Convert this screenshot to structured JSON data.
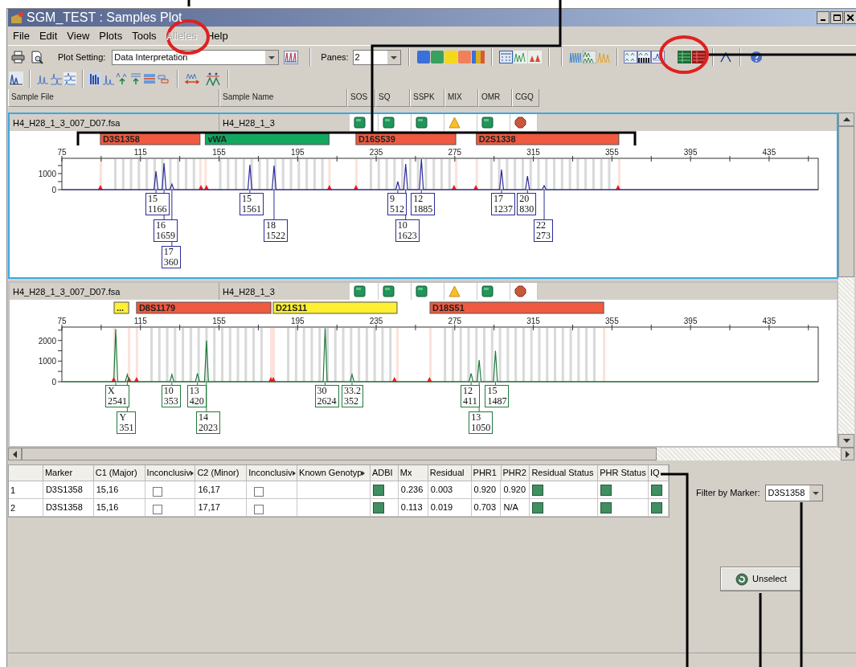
{
  "window": {
    "title": "SGM_TEST : Samples Plot"
  },
  "menu": [
    {
      "label": "File",
      "disabled": false
    },
    {
      "label": "Edit",
      "disabled": false
    },
    {
      "label": "View",
      "disabled": false
    },
    {
      "label": "Plots",
      "disabled": false
    },
    {
      "label": "Tools",
      "disabled": false
    },
    {
      "label": "Alleles",
      "disabled": true
    },
    {
      "label": "Help",
      "disabled": false
    }
  ],
  "toolbar": {
    "plot_setting_label": "Plot Setting:",
    "plot_setting_value": "Data Interpretation",
    "panes_label": "Panes:",
    "panes_value": "2"
  },
  "columns": [
    "Sample File",
    "Sample Name",
    "SOS",
    "SQ",
    "SSPK",
    "MIX",
    "OMR",
    "CGQ"
  ],
  "panes": [
    {
      "sample_file": "H4_H28_1_3_007_D07.fsa",
      "sample_name": "H4_H28_1_3",
      "selected": true,
      "statuses": [
        {
          "kind": "pass"
        },
        {
          "kind": "pass"
        },
        {
          "kind": "pass"
        },
        {
          "kind": "warn"
        },
        {
          "kind": "pass"
        },
        {
          "kind": "fail"
        }
      ],
      "markers": [
        {
          "label": "D3S1358",
          "color": "#ef5a40"
        },
        {
          "label": "vWA",
          "color": "#12a860"
        },
        {
          "label": "D16S539",
          "color": "#ef5a40"
        },
        {
          "label": "D2S1338",
          "color": "#ef5a40"
        }
      ],
      "chart_data": {
        "type": "line",
        "xlim": [
          75,
          460
        ],
        "ylim": [
          0,
          1950
        ],
        "xticks": [
          75,
          115,
          155,
          195,
          235,
          275,
          315,
          355,
          395,
          435
        ],
        "yticks": [
          0,
          1000
        ],
        "x": [
          75,
          121.9,
          122.9,
          123.9,
          126,
          127,
          128,
          130,
          131,
          132,
          169.7,
          170.7,
          171.7,
          182,
          183,
          184,
          245,
          246,
          247,
          249,
          250,
          251,
          257,
          258,
          259,
          297.8,
          298.8,
          299.8,
          311,
          312,
          313,
          319.5,
          320.5,
          321.5,
          460
        ],
        "series": [
          {
            "color": "#2b2b9c",
            "values": [
              0,
              0,
              1150,
              0,
              0,
              1650,
              0,
              0,
              350,
              0,
              0,
              1550,
              0,
              0,
              1500,
              0,
              0,
              500,
              0,
              0,
              1600,
              0,
              0,
              1900,
              0,
              0,
              1250,
              0,
              0,
              850,
              0,
              0,
              250,
              0,
              0
            ]
          }
        ]
      },
      "peak_labels": [
        {
          "allele": "15",
          "rfu": "1166"
        },
        {
          "allele": "16",
          "rfu": "1659"
        },
        {
          "allele": "17",
          "rfu": "360"
        },
        {
          "allele": "15",
          "rfu": "1561"
        },
        {
          "allele": "18",
          "rfu": "1522"
        },
        {
          "allele": "9",
          "rfu": "512"
        },
        {
          "allele": "10",
          "rfu": "1623"
        },
        {
          "allele": "12",
          "rfu": "1885"
        },
        {
          "allele": "17",
          "rfu": "1237"
        },
        {
          "allele": "20",
          "rfu": "830"
        },
        {
          "allele": "22",
          "rfu": "273"
        }
      ]
    },
    {
      "sample_file": "H4_H28_1_3_007_D07.fsa",
      "sample_name": "H4_H28_1_3",
      "selected": false,
      "statuses": [
        {
          "kind": "pass"
        },
        {
          "kind": "pass"
        },
        {
          "kind": "pass"
        },
        {
          "kind": "warn"
        },
        {
          "kind": "pass"
        },
        {
          "kind": "fail"
        }
      ],
      "markers": [
        {
          "label": "...",
          "color": "#fff033"
        },
        {
          "label": "D8S1179",
          "color": "#ef5a40"
        },
        {
          "label": "D21S11",
          "color": "#fff033"
        },
        {
          "label": "D18S51",
          "color": "#ef5a40"
        }
      ],
      "chart_data": {
        "type": "line",
        "xlim": [
          75,
          460
        ],
        "ylim": [
          0,
          2650
        ],
        "xticks": [
          75,
          115,
          155,
          195,
          235,
          275,
          315,
          355,
          395,
          435
        ],
        "yticks": [
          0,
          1000,
          2000
        ],
        "x": [
          75,
          101.4,
          102.4,
          103.4,
          107.3,
          108.3,
          109.3,
          130,
          131,
          132,
          143,
          144,
          145,
          147.6,
          148.6,
          149.6,
          208,
          209,
          210,
          221.7,
          222.7,
          223.7,
          282.3,
          283.3,
          284.3,
          286.4,
          287.4,
          288.4,
          294.7,
          295.7,
          296.7,
          460
        ],
        "series": [
          {
            "color": "#1f7a3c",
            "values": [
              0,
              0,
              2550,
              0,
              0,
              350,
              0,
              0,
              350,
              0,
              0,
              400,
              0,
              0,
              2000,
              0,
              0,
              2600,
              0,
              0,
              350,
              0,
              0,
              400,
              0,
              0,
              1050,
              0,
              0,
              1500,
              0,
              0
            ]
          }
        ]
      },
      "peak_labels": [
        {
          "allele": "X",
          "rfu": "2541"
        },
        {
          "allele": "Y",
          "rfu": "351"
        },
        {
          "allele": "10",
          "rfu": "353"
        },
        {
          "allele": "13",
          "rfu": "420"
        },
        {
          "allele": "14",
          "rfu": "2023"
        },
        {
          "allele": "30",
          "rfu": "2624"
        },
        {
          "allele": "33.2",
          "rfu": "352"
        },
        {
          "allele": "12",
          "rfu": "411"
        },
        {
          "allele": "13",
          "rfu": "1050"
        },
        {
          "allele": "15",
          "rfu": "1487"
        }
      ]
    }
  ],
  "table": {
    "columns": [
      {
        "label": "Marker",
        "sorted": false
      },
      {
        "label": "C1 (Major)",
        "sorted": false
      },
      {
        "label": "Inconclusiv",
        "sorted": true
      },
      {
        "label": "C2 (Minor)",
        "sorted": false
      },
      {
        "label": "Inconclusiv",
        "sorted": true
      },
      {
        "label": "Known Genotyp",
        "sorted": true
      },
      {
        "label": "ADBI",
        "sorted": false
      },
      {
        "label": "Mx",
        "sorted": false
      },
      {
        "label": "Residual",
        "sorted": false
      },
      {
        "label": "PHR1",
        "sorted": false
      },
      {
        "label": "PHR2",
        "sorted": false
      },
      {
        "label": "Residual Status",
        "sorted": false
      },
      {
        "label": "PHR Status",
        "sorted": false
      },
      {
        "label": "IQ",
        "sorted": false
      }
    ],
    "rows": [
      {
        "number": "1",
        "cells": [
          {
            "kind": "text",
            "text": "D3S1358"
          },
          {
            "kind": "text",
            "text": "15,16"
          },
          {
            "kind": "checkbox",
            "checked": false
          },
          {
            "kind": "text",
            "text": "16,17"
          },
          {
            "kind": "checkbox",
            "checked": false
          },
          {
            "kind": "empty"
          },
          {
            "kind": "status",
            "passed": true
          },
          {
            "kind": "text",
            "text": "0.236"
          },
          {
            "kind": "text",
            "text": "0.003"
          },
          {
            "kind": "text",
            "text": "0.920"
          },
          {
            "kind": "text",
            "text": "0.920"
          },
          {
            "kind": "status",
            "passed": true
          },
          {
            "kind": "status",
            "passed": true
          },
          {
            "kind": "status",
            "passed": true
          }
        ]
      },
      {
        "number": "2",
        "cells": [
          {
            "kind": "text",
            "text": "D3S1358"
          },
          {
            "kind": "text",
            "text": "15,16"
          },
          {
            "kind": "checkbox",
            "checked": false
          },
          {
            "kind": "text",
            "text": "17,17"
          },
          {
            "kind": "checkbox",
            "checked": false
          },
          {
            "kind": "empty"
          },
          {
            "kind": "status",
            "passed": true
          },
          {
            "kind": "text",
            "text": "0.113"
          },
          {
            "kind": "text",
            "text": "0.019"
          },
          {
            "kind": "text",
            "text": "0.703"
          },
          {
            "kind": "text",
            "text": "N/A"
          },
          {
            "kind": "status",
            "passed": true
          },
          {
            "kind": "status",
            "passed": true
          },
          {
            "kind": "status",
            "passed": true
          }
        ]
      }
    ]
  },
  "filter": {
    "label": "Filter by Marker:",
    "value": "D3S1358"
  },
  "unselect_button": {
    "label": "Unselect"
  }
}
